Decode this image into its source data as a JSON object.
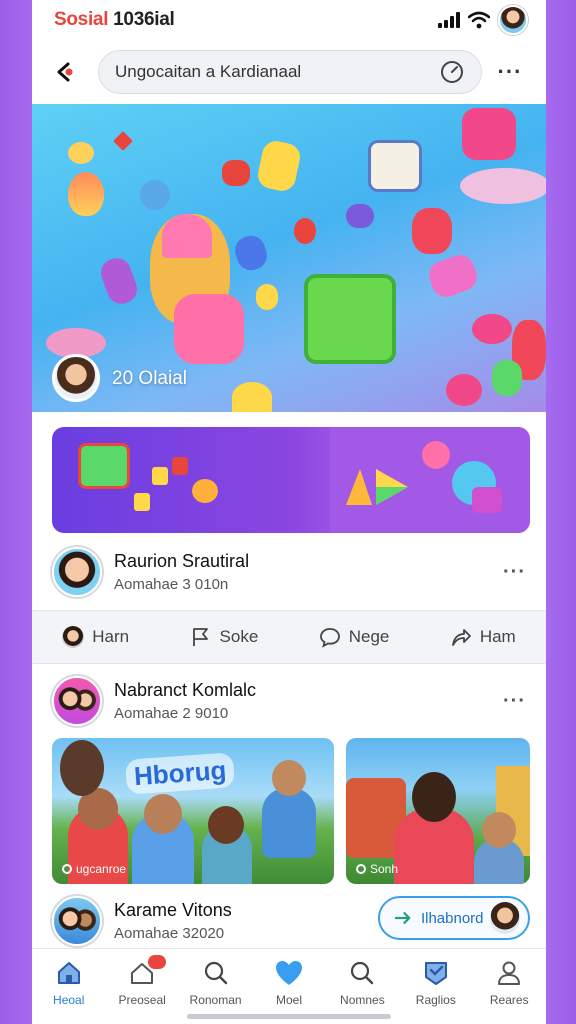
{
  "status": {
    "title_part1": "Sosial",
    "title_part2": "1036ial"
  },
  "search": {
    "text": "Ungocaitan a Kardianaal"
  },
  "hero": {
    "label": "20 Olaial"
  },
  "posts": [
    {
      "name": "Raurion Srautiral",
      "subtitle": "Aomahae 3 010n"
    },
    {
      "name": "Nabranct Komlalc",
      "subtitle": "Aomahae 2 9010"
    },
    {
      "name": "Karame Vitons",
      "subtitle": "Aomahae 32020"
    }
  ],
  "actions": [
    {
      "label": "Harn",
      "icon": "avatar-icon"
    },
    {
      "label": "Soke",
      "icon": "flag-icon"
    },
    {
      "label": "Nege",
      "icon": "comment-icon"
    },
    {
      "label": "Ham",
      "icon": "share-icon"
    }
  ],
  "photos": {
    "photo1_sign": "Hborug",
    "photo1_caption": "ugcanroe",
    "photo2_caption": "Sonh"
  },
  "follow_button": {
    "label": "Ilhabnord"
  },
  "tabs": [
    {
      "label": "Heoal",
      "icon": "home-icon",
      "active": true
    },
    {
      "label": "Preoseal",
      "icon": "notifications-icon"
    },
    {
      "label": "Ronoman",
      "icon": "search-icon"
    },
    {
      "label": "Moel",
      "icon": "heart-icon"
    },
    {
      "label": "Nomnes",
      "icon": "explore-icon"
    },
    {
      "label": "Raglios",
      "icon": "badge-icon"
    },
    {
      "label": "Reares",
      "icon": "profile-icon"
    }
  ],
  "colors": {
    "accent": "#1e7fd8",
    "brand_red": "#e8453c",
    "frame_purple": "#9b5de5"
  }
}
